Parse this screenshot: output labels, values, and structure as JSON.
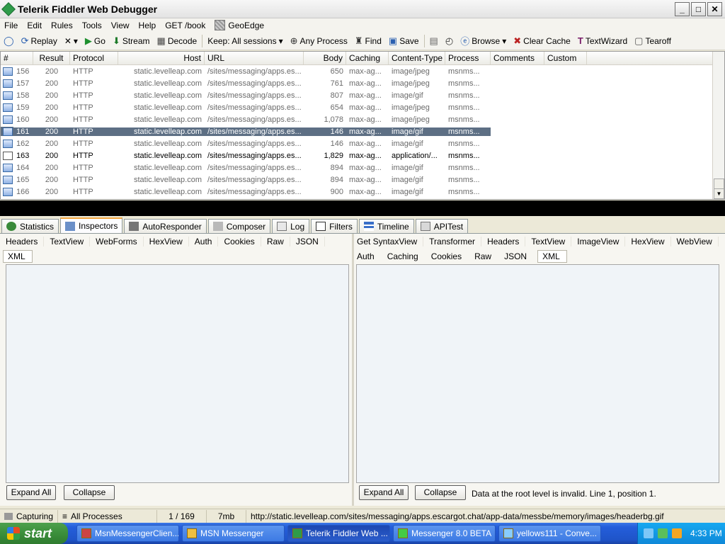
{
  "window": {
    "title": "Telerik Fiddler Web Debugger",
    "btn_min": "_",
    "btn_max": "□",
    "btn_close": "✕"
  },
  "menu": [
    "File",
    "Edit",
    "Rules",
    "Tools",
    "View",
    "Help",
    "GET /book"
  ],
  "menu_geo": "GeoEdge",
  "toolbar": {
    "replay": "Replay",
    "remove": "✕",
    "go": "Go",
    "stream": "Stream",
    "decode": "Decode",
    "keep": "Keep: All sessions",
    "any_process": "Any Process",
    "find": "Find",
    "save": "Save",
    "browse": "Browse",
    "clear_cache": "Clear Cache",
    "textwizard": "TextWizard",
    "tearoff": "Tearoff"
  },
  "columns": [
    "#",
    "Result",
    "Protocol",
    "Host",
    "URL",
    "Body",
    "Caching",
    "Content-Type",
    "Process",
    "Comments",
    "Custom"
  ],
  "sessions": [
    {
      "num": "156",
      "result": "200",
      "protocol": "HTTP",
      "host": "static.levelleap.com",
      "url": "/sites/messaging/apps.es...",
      "body": "650",
      "caching": "max-ag...",
      "ctype": "image/jpeg",
      "process": "msnms..."
    },
    {
      "num": "157",
      "result": "200",
      "protocol": "HTTP",
      "host": "static.levelleap.com",
      "url": "/sites/messaging/apps.es...",
      "body": "761",
      "caching": "max-ag...",
      "ctype": "image/jpeg",
      "process": "msnms..."
    },
    {
      "num": "158",
      "result": "200",
      "protocol": "HTTP",
      "host": "static.levelleap.com",
      "url": "/sites/messaging/apps.es...",
      "body": "807",
      "caching": "max-ag...",
      "ctype": "image/gif",
      "process": "msnms..."
    },
    {
      "num": "159",
      "result": "200",
      "protocol": "HTTP",
      "host": "static.levelleap.com",
      "url": "/sites/messaging/apps.es...",
      "body": "654",
      "caching": "max-ag...",
      "ctype": "image/jpeg",
      "process": "msnms..."
    },
    {
      "num": "160",
      "result": "200",
      "protocol": "HTTP",
      "host": "static.levelleap.com",
      "url": "/sites/messaging/apps.es...",
      "body": "1,078",
      "caching": "max-ag...",
      "ctype": "image/jpeg",
      "process": "msnms..."
    },
    {
      "num": "161",
      "result": "200",
      "protocol": "HTTP",
      "host": "static.levelleap.com",
      "url": "/sites/messaging/apps.es...",
      "body": "146",
      "caching": "max-ag...",
      "ctype": "image/gif",
      "process": "msnms..."
    },
    {
      "num": "162",
      "result": "200",
      "protocol": "HTTP",
      "host": "static.levelleap.com",
      "url": "/sites/messaging/apps.es...",
      "body": "146",
      "caching": "max-ag...",
      "ctype": "image/gif",
      "process": "msnms..."
    },
    {
      "num": "163",
      "result": "200",
      "protocol": "HTTP",
      "host": "static.levelleap.com",
      "url": "/sites/messaging/apps.es...",
      "body": "1,829",
      "caching": "max-ag...",
      "ctype": "application/...",
      "process": "msnms..."
    },
    {
      "num": "164",
      "result": "200",
      "protocol": "HTTP",
      "host": "static.levelleap.com",
      "url": "/sites/messaging/apps.es...",
      "body": "894",
      "caching": "max-ag...",
      "ctype": "image/gif",
      "process": "msnms..."
    },
    {
      "num": "165",
      "result": "200",
      "protocol": "HTTP",
      "host": "static.levelleap.com",
      "url": "/sites/messaging/apps.es...",
      "body": "894",
      "caching": "max-ag...",
      "ctype": "image/gif",
      "process": "msnms..."
    },
    {
      "num": "166",
      "result": "200",
      "protocol": "HTTP",
      "host": "static.levelleap.com",
      "url": "/sites/messaging/apps.es...",
      "body": "900",
      "caching": "max-ag...",
      "ctype": "image/gif",
      "process": "msnms..."
    }
  ],
  "tabs": [
    "Statistics",
    "Inspectors",
    "AutoResponder",
    "Composer",
    "Log",
    "Filters",
    "Timeline",
    "APITest"
  ],
  "request_tabs": [
    "Headers",
    "TextView",
    "WebForms",
    "HexView",
    "Auth",
    "Cookies",
    "Raw",
    "JSON"
  ],
  "request_sub": "XML",
  "response_tabs": [
    "Get SyntaxView",
    "Transformer",
    "Headers",
    "TextView",
    "ImageView",
    "HexView",
    "WebView"
  ],
  "response_tabs2": [
    "Auth",
    "Caching",
    "Cookies",
    "Raw",
    "JSON"
  ],
  "response_sub": "XML",
  "buttons": {
    "expand_all": "Expand All",
    "collapse": "Collapse"
  },
  "error_text": "Data at the root level is invalid. Line 1, position 1.",
  "status": {
    "capturing": "Capturing",
    "processes": "All Processes",
    "count": "1 / 169",
    "size": "7mb",
    "url": "http://static.levelleap.com/sites/messaging/apps.escargot.chat/app-data/messbe/memory/images/headerbg.gif"
  },
  "taskbar": {
    "start": "start",
    "tasks": [
      "MsnMessengerClien...",
      "MSN Messenger",
      "Telerik Fiddler Web ...",
      "Messenger 8.0 BETA",
      "yellows111 - Conve..."
    ],
    "clock": "4:33 PM"
  }
}
